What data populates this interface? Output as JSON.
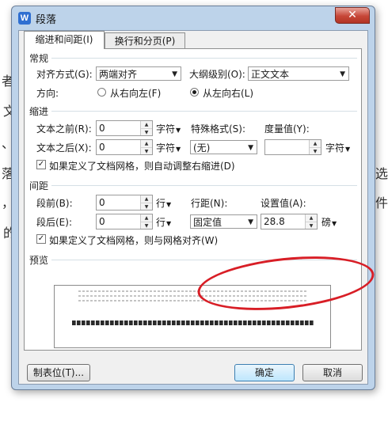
{
  "window": {
    "title": "段落",
    "app_icon": "W",
    "close_glyph": "✕"
  },
  "tabs": [
    {
      "label": "缩进和间距(I)",
      "active": true
    },
    {
      "label": "换行和分页(P)",
      "active": false
    }
  ],
  "general": {
    "section": "常规",
    "align_label": "对齐方式(G):",
    "align_value": "两端对齐",
    "outline_label": "大纲级别(O):",
    "outline_value": "正文文本",
    "direction_label": "方向:",
    "rtl_label": "从右向左(F)",
    "ltr_label": "从左向右(L)",
    "selected_direction": "ltr"
  },
  "indent": {
    "section": "缩进",
    "before_label": "文本之前(R):",
    "before_value": "0",
    "before_unit": "字符",
    "after_label": "文本之后(X):",
    "after_value": "0",
    "after_unit": "字符",
    "special_label": "特殊格式(S):",
    "special_value": "(无)",
    "measure_label": "度量值(Y):",
    "measure_value": "",
    "measure_unit": "字符",
    "auto_adjust_label": "如果定义了文档网格，则自动调整右缩进(D)",
    "auto_adjust_checked": true
  },
  "spacing": {
    "section": "间距",
    "before_label": "段前(B):",
    "before_value": "0",
    "before_unit": "行",
    "after_label": "段后(E):",
    "after_value": "0",
    "after_unit": "行",
    "line_label": "行距(N):",
    "line_value": "固定值",
    "setvalue_label": "设置值(A):",
    "setvalue_value": "28.8",
    "setvalue_unit": "磅",
    "grid_align_label": "如果定义了文档网格，则与网格对齐(W)",
    "grid_align_checked": true
  },
  "preview": {
    "section": "预览"
  },
  "buttons": {
    "tabs": "制表位(T)...",
    "ok": "确定",
    "cancel": "取消"
  },
  "background_text": [
    "者",
    "文",
    "、",
    "落",
    "，",
    "的",
    "选",
    "件"
  ],
  "colors": {
    "dialog_frame": "#bdd3ea",
    "close_button": "#c64637",
    "annotation": "#d81e26"
  }
}
